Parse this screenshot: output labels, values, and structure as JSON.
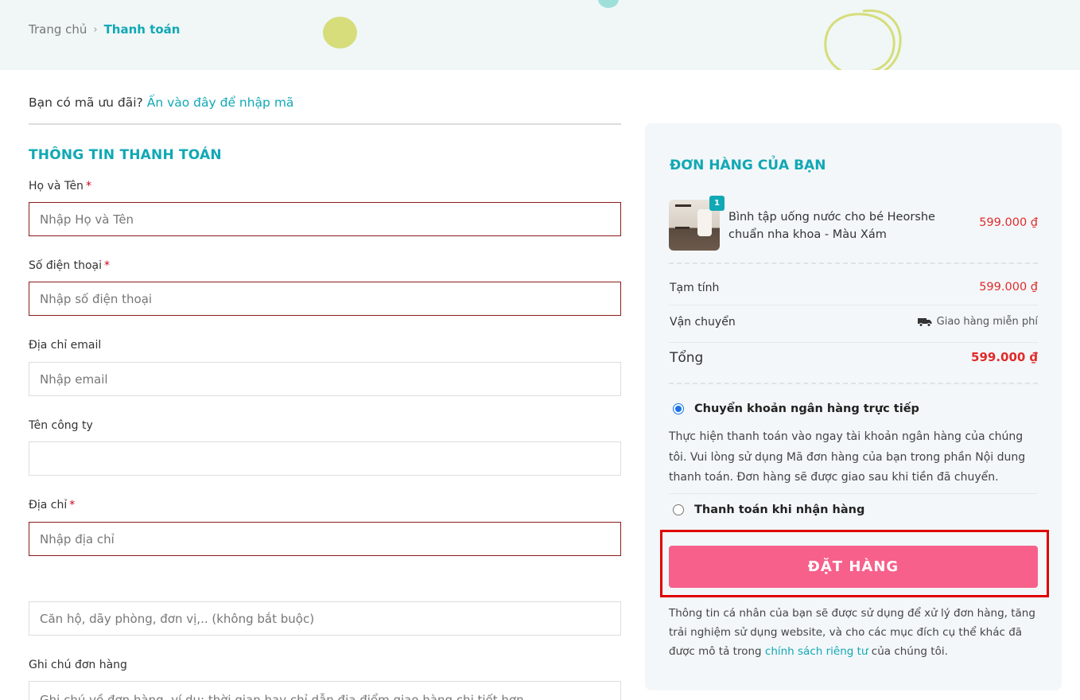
{
  "breadcrumb": {
    "home": "Trang chủ",
    "separator": "›",
    "current": "Thanh toán"
  },
  "coupon": {
    "question": "Bạn có mã ưu đãi?",
    "link": "Ấn vào đây để nhập mã"
  },
  "billing": {
    "title": "THÔNG TIN THANH TOÁN",
    "required_mark": "*",
    "fields": {
      "fullname": {
        "label": "Họ và Tên",
        "placeholder": "Nhập Họ và Tên",
        "value": ""
      },
      "phone": {
        "label": "Số điện thoại",
        "placeholder": "Nhập số điện thoại",
        "value": ""
      },
      "email": {
        "label": "Địa chỉ email",
        "placeholder": "Nhập email",
        "value": ""
      },
      "company": {
        "label": "Tên công ty",
        "placeholder": "",
        "value": ""
      },
      "address": {
        "label": "Địa chỉ",
        "placeholder": "Nhập địa chỉ",
        "value": ""
      },
      "address2": {
        "placeholder": "Căn hộ, dãy phòng, đơn vị,.. (không bắt buộc)",
        "value": ""
      },
      "notes": {
        "label": "Ghi chú đơn hàng",
        "placeholder": "Ghi chú về đơn hàng, ví dụ: thời gian hay chỉ dẫn địa điểm giao hàng chi tiết hơn.",
        "value": ""
      }
    }
  },
  "order": {
    "title": "ĐƠN HÀNG CỦA BẠN",
    "item": {
      "name": "Bình tập uống nước cho bé Heorshe chuẩn nha khoa - Màu Xám",
      "quantity": "1",
      "price": "599.000 ₫"
    },
    "subtotal": {
      "label": "Tạm tính",
      "value": "599.000 ₫"
    },
    "shipping": {
      "label": "Vận chuyển",
      "value": "Giao hàng miễn phí",
      "icon": "truck-icon"
    },
    "total": {
      "label": "Tổng",
      "value": "599.000 ₫"
    },
    "payment_methods": [
      {
        "label": "Chuyển khoản ngân hàng trực tiếp",
        "selected": true,
        "description": "Thực hiện thanh toán vào ngay tài khoản ngân hàng của chúng tôi. Vui lòng sử dụng Mã đơn hàng của bạn trong phần Nội dung thanh toán. Đơn hàng sẽ được giao sau khi tiền đã chuyển."
      },
      {
        "label": "Thanh toán khi nhận hàng",
        "selected": false
      }
    ],
    "place_order_label": "ĐẶT HÀNG",
    "privacy": {
      "before": "Thông tin cá nhân của bạn sẽ được sử dụng để xử lý đơn hàng, tăng trải nghiệm sử dụng website, và cho các mục đích cụ thể khác đã được mô tả trong",
      "link": "chính sách riêng tư",
      "after": "của chúng tôi."
    }
  },
  "colors": {
    "accent": "#11a8b5",
    "price": "#e02b2b",
    "button": "#f7608b",
    "required_border": "#8b1a1a",
    "highlight_frame": "#e00000"
  }
}
